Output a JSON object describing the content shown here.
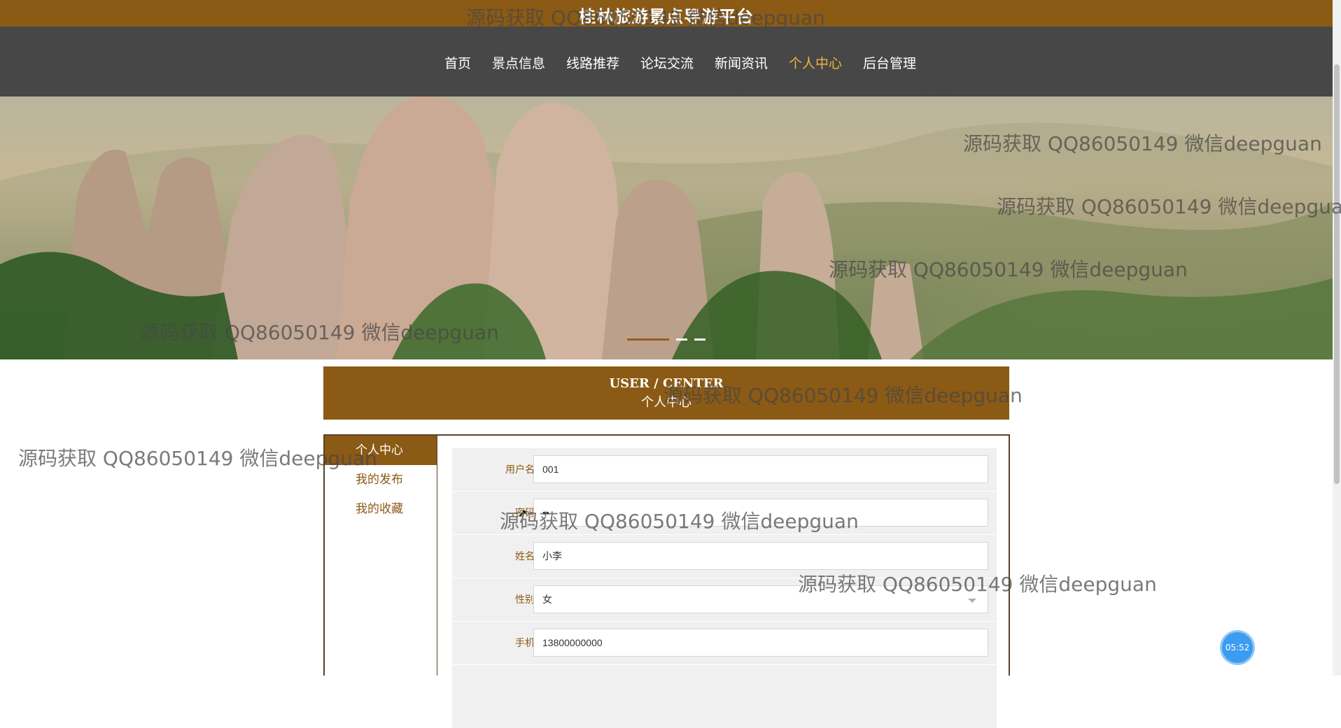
{
  "header": {
    "site_title": "桂林旅游景点导游平台"
  },
  "nav": {
    "items": [
      {
        "label": "首页"
      },
      {
        "label": "景点信息"
      },
      {
        "label": "线路推荐"
      },
      {
        "label": "论坛交流"
      },
      {
        "label": "新闻资讯"
      },
      {
        "label": "个人中心",
        "active": true
      },
      {
        "label": "后台管理"
      }
    ]
  },
  "banner": {
    "active_slide": 1,
    "slide_count": 3
  },
  "user_center": {
    "title_en": "USER / CENTER",
    "title_zh": "个人中心"
  },
  "sidebar": {
    "items": [
      {
        "label": "个人中心",
        "active": true
      },
      {
        "label": "我的发布"
      },
      {
        "label": "我的收藏"
      }
    ]
  },
  "form": {
    "fields": [
      {
        "label": "用户名",
        "value": "001"
      },
      {
        "label": "密码",
        "value": "••"
      },
      {
        "label": "姓名",
        "value": "小李"
      },
      {
        "label": "性别",
        "value": "女"
      },
      {
        "label": "手机",
        "value": "13800000000"
      }
    ]
  },
  "timer": {
    "text": "05:52"
  },
  "watermark": {
    "text": "源码获取 QQ86050149 微信deepguan"
  },
  "colors": {
    "brand": "#8b5a14",
    "nav_bg": "#474747",
    "nav_active": "#f0b43c"
  }
}
